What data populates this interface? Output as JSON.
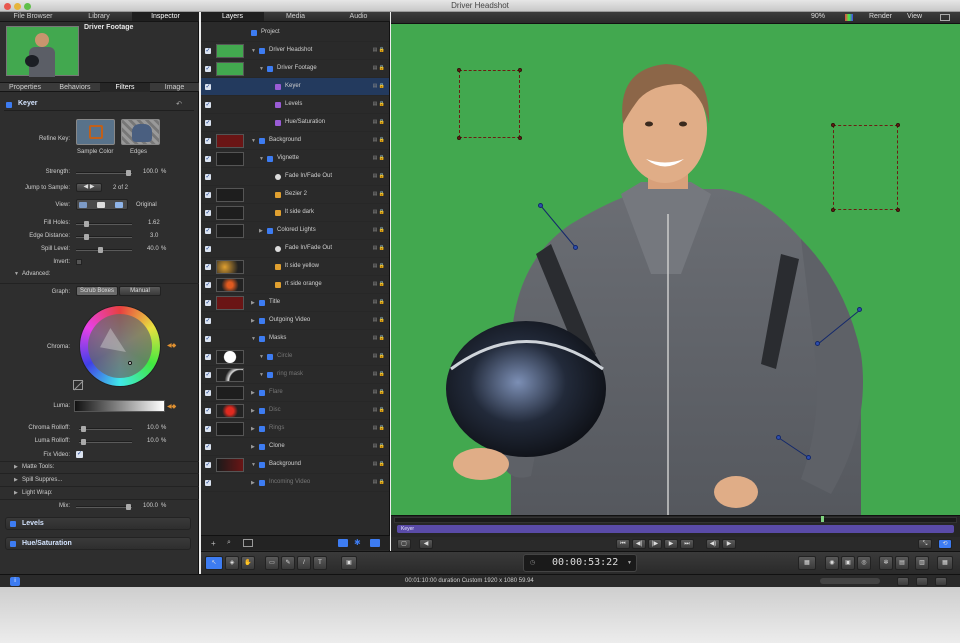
{
  "window": {
    "title": "Driver Headshot"
  },
  "topTabs": [
    "File Browser",
    "Library",
    "Inspector"
  ],
  "layerTabs": [
    "Layers",
    "Media",
    "Audio"
  ],
  "canvasBar": {
    "zoom": "90%",
    "render": "Render",
    "view": "View"
  },
  "inspector": {
    "clipTitle": "Driver Footage",
    "subTabs": [
      "Properties",
      "Behaviors",
      "Filters",
      "Image"
    ],
    "keyer": {
      "title": "Keyer",
      "refineKey": "Refine Key:",
      "sampleColor": "Sample Color",
      "edges": "Edges",
      "strength": {
        "label": "Strength:",
        "value": "100.0",
        "unit": "%"
      },
      "jump": {
        "label": "Jump to Sample:",
        "value": "2 of 2"
      },
      "view": {
        "label": "View:",
        "value": "Original"
      },
      "fillHoles": {
        "label": "Fill Holes:",
        "value": "1.62"
      },
      "edgeDistance": {
        "label": "Edge Distance:",
        "value": "3.0"
      },
      "spillLevel": {
        "label": "Spill Level:",
        "value": "40.0",
        "unit": "%"
      },
      "invert": "Invert:",
      "advanced": "Advanced:",
      "graph": {
        "label": "Graph:",
        "options": [
          "Scrub Boxes",
          "Manual"
        ]
      },
      "chroma": "Chroma:",
      "luma": "Luma:",
      "chromaRolloff": {
        "label": "Chroma Rolloff:",
        "value": "10.0",
        "unit": "%"
      },
      "lumaRolloff": {
        "label": "Luma Rolloff:",
        "value": "10.0",
        "unit": "%"
      },
      "fixVideo": "Fix Video:",
      "matteTools": "Matte Tools:",
      "spillSuppress": "Spill Suppres...",
      "lightWrap": "Light Wrap:",
      "mix": {
        "label": "Mix:",
        "value": "100.0",
        "unit": "%"
      }
    },
    "levels": "Levels",
    "hueSat": "Hue/Saturation"
  },
  "layers": [
    {
      "name": "Project",
      "thumb": "none",
      "indent": 0
    },
    {
      "name": "Driver Headshot",
      "thumb": "green",
      "indent": 1
    },
    {
      "name": "Driver Footage",
      "thumb": "green",
      "indent": 2
    },
    {
      "name": "Keyer",
      "thumb": "none",
      "indent": 3,
      "selected": true
    },
    {
      "name": "Levels",
      "thumb": "none",
      "indent": 3
    },
    {
      "name": "Hue/Saturation",
      "thumb": "none",
      "indent": 3
    },
    {
      "name": "Background",
      "thumb": "red",
      "indent": 1
    },
    {
      "name": "Vignette",
      "thumb": "dark",
      "indent": 2
    },
    {
      "name": "Fade In/Fade Out",
      "thumb": "none",
      "indent": 3
    },
    {
      "name": "Bezier 2",
      "thumb": "dark",
      "indent": 3
    },
    {
      "name": "lt side dark",
      "thumb": "dark",
      "indent": 3
    },
    {
      "name": "Colored Lights",
      "thumb": "dark",
      "indent": 2
    },
    {
      "name": "Fade In/Fade Out",
      "thumb": "none",
      "indent": 3
    },
    {
      "name": "lt side yellow",
      "thumb": "orange",
      "indent": 3
    },
    {
      "name": "rt side orange",
      "thumb": "orangeDot",
      "indent": 3
    },
    {
      "name": "Title",
      "thumb": "red",
      "indent": 1
    },
    {
      "name": "Outgoing Video",
      "thumb": "none",
      "indent": 1
    },
    {
      "name": "Masks",
      "thumb": "none",
      "indent": 1
    },
    {
      "name": "Circle",
      "thumb": "white",
      "indent": 2,
      "dim": true
    },
    {
      "name": "ring mask",
      "thumb": "ring",
      "indent": 2,
      "dim": true
    },
    {
      "name": "Flare",
      "thumb": "dark",
      "indent": 1,
      "dim": true
    },
    {
      "name": "Disc",
      "thumb": "redDot",
      "indent": 1,
      "dim": true
    },
    {
      "name": "Rings",
      "thumb": "dark",
      "indent": 1,
      "dim": true
    },
    {
      "name": "Clone",
      "thumb": "none",
      "indent": 1
    },
    {
      "name": "Background",
      "thumb": "redDark",
      "indent": 1
    },
    {
      "name": "Incoming Video",
      "thumb": "none",
      "indent": 1,
      "dim": true
    }
  ],
  "timeline": {
    "label": "Keyer",
    "timecode": "00:00:53:22"
  },
  "status": {
    "text": "00:01:10:00 duration Custom 1920 x 1080 59.94"
  },
  "colors": {
    "green": "#42a84f",
    "panel": "#2e2e2e",
    "accent": "#3d7cf2"
  }
}
